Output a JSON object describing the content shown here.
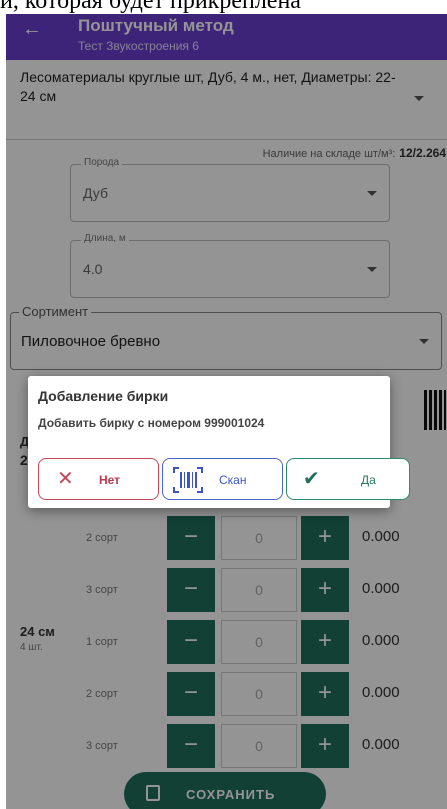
{
  "caption": "й, которая будет прикреплена",
  "appbar": {
    "title": "Поштучный метод",
    "subtitle": "Тест Звукостроения 6"
  },
  "product": {
    "text": "Лесоматериалы круглые шт, Дуб, 4 м., нет, Диаметры: 22-24 см"
  },
  "stock": {
    "label": "Наличие на складе шт/м³:",
    "value": "12/2.264"
  },
  "fields": [
    {
      "label": "Порода",
      "value": "Дуб"
    },
    {
      "label": "Длина, м",
      "value": "4.0"
    }
  ],
  "sortiment": {
    "label": "Сортимент",
    "value": "Пиловочное бревно"
  },
  "rows": [
    {
      "grade": "2 сорт",
      "qty": "0",
      "amount": "0.000"
    },
    {
      "grade": "3 сорт",
      "qty": "0",
      "amount": "0.000"
    },
    {
      "grade": "1 сорт",
      "qty": "0",
      "amount": "0.000"
    },
    {
      "grade": "2 сорт",
      "qty": "0",
      "amount": "0.000"
    },
    {
      "grade": "3 сорт",
      "qty": "0",
      "amount": "0.000"
    }
  ],
  "diameter_groups": [
    {
      "label": "22",
      "sub": "Д"
    },
    {
      "label": "24 см",
      "sub": "4 шт."
    }
  ],
  "save_label": "СОХРАНИТЬ",
  "dialog": {
    "title": "Добавление бирки",
    "message": "Добавить бирку с номером 999001024",
    "no": "Нет",
    "scan": "Скан",
    "yes": "Да"
  },
  "icons": {
    "back": "arrow-left-icon",
    "dropdown": "chevron-down-icon",
    "save": "floppy-disk-icon",
    "no": "close-icon",
    "scan": "barcode-icon",
    "yes": "check-icon"
  },
  "colors": {
    "appbar": "#6a3fd0",
    "primary_button": "#1f6f5a",
    "no": "#c7475a",
    "scan": "#4a64c9",
    "yes": "#2e8a6e"
  }
}
